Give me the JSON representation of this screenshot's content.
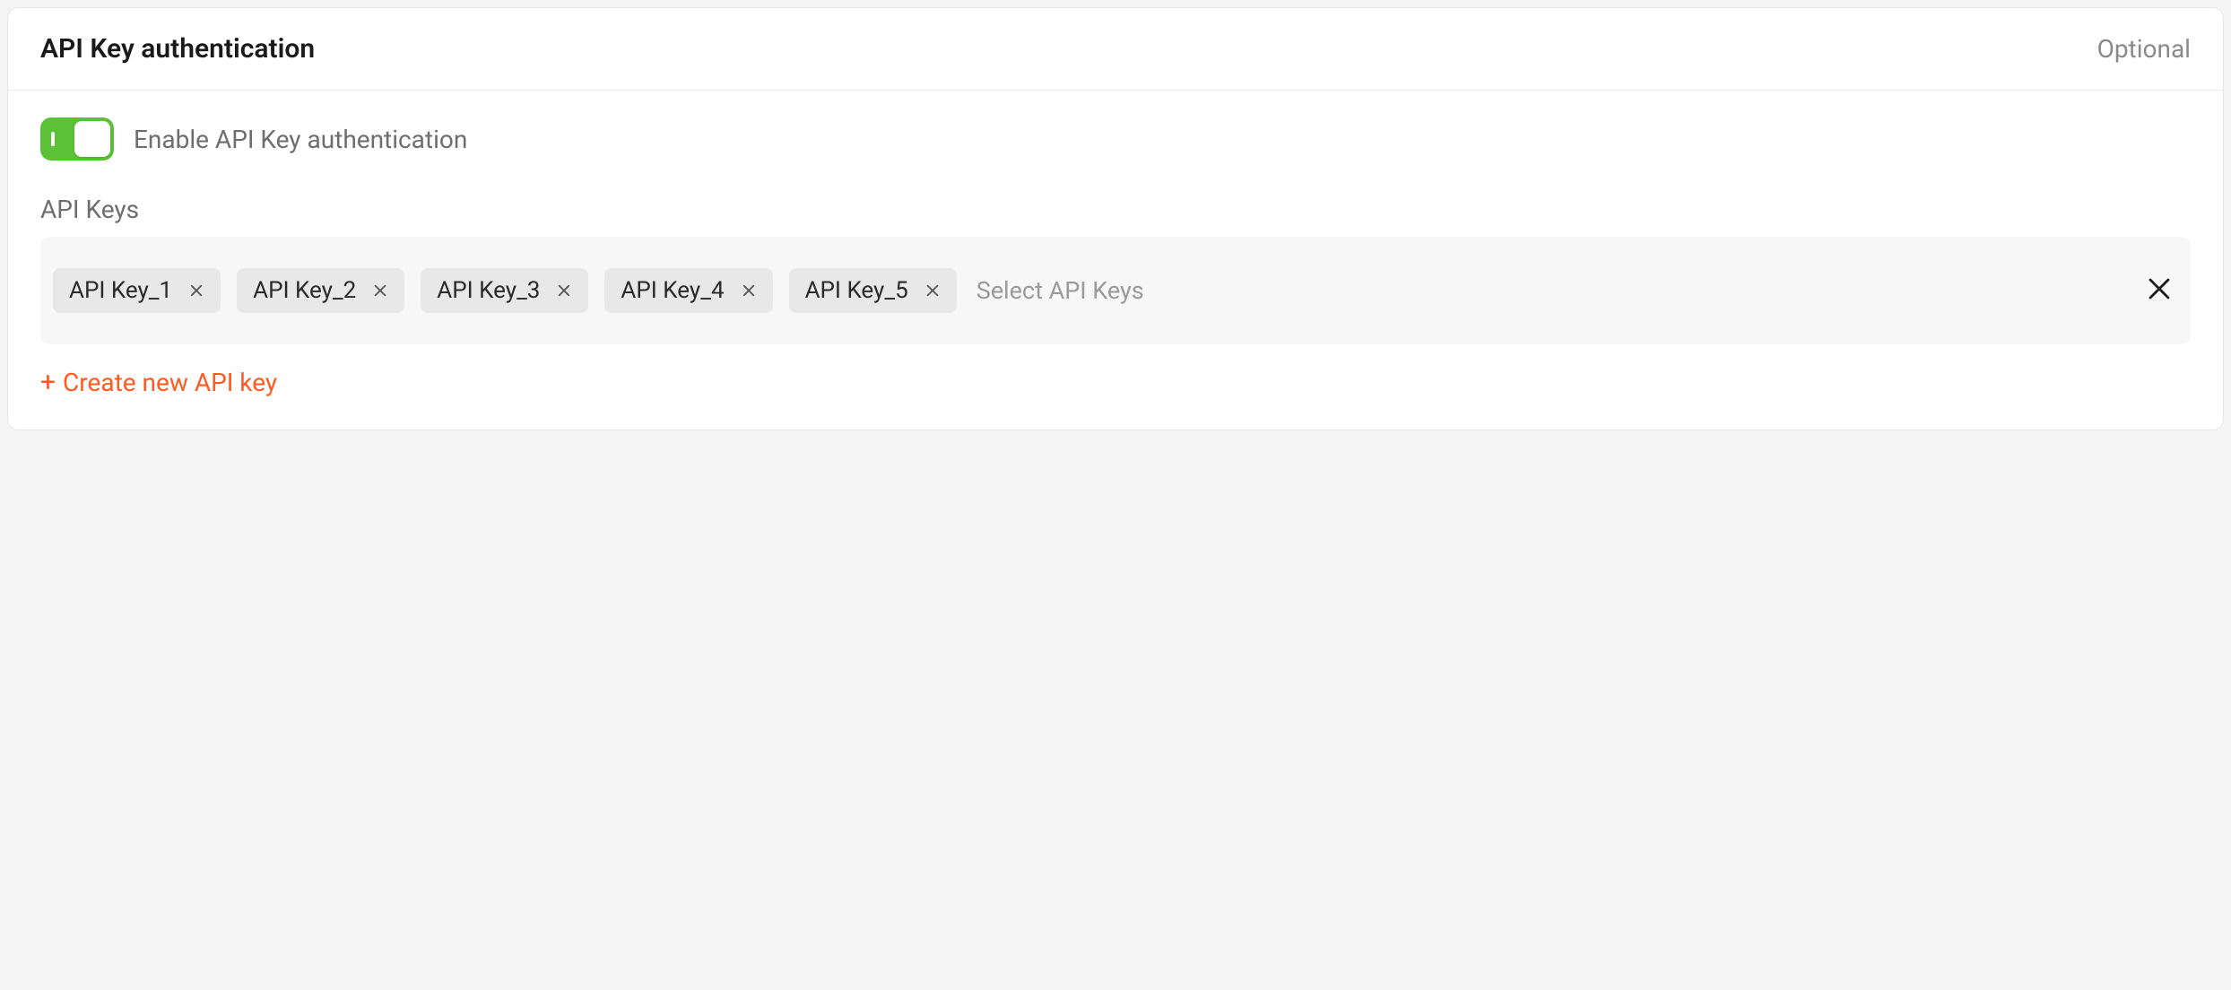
{
  "header": {
    "title": "API Key authentication",
    "badge": "Optional"
  },
  "toggle": {
    "label": "Enable API Key authentication",
    "enabled": true
  },
  "keys": {
    "section_label": "API Keys",
    "placeholder": "Select API Keys",
    "items": [
      {
        "label": "API Key_1"
      },
      {
        "label": "API Key_2"
      },
      {
        "label": "API Key_3"
      },
      {
        "label": "API Key_4"
      },
      {
        "label": "API Key_5"
      }
    ]
  },
  "create": {
    "label": "Create new API key"
  },
  "colors": {
    "accent": "#ff5a1f",
    "toggle_on": "#5bc236"
  }
}
